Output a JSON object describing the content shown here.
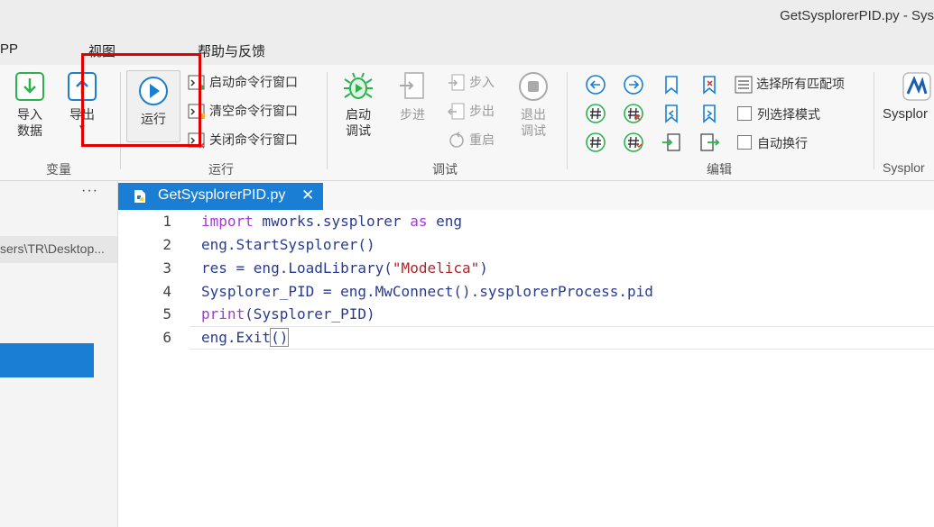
{
  "window": {
    "title": "GetSysplorerPID.py - Sys"
  },
  "menu": [
    "PP",
    "视图",
    "帮助与反馈"
  ],
  "ribbon": {
    "variables": {
      "import_label": [
        "导入",
        "数据"
      ],
      "export_label": [
        "导出"
      ],
      "group": "变量"
    },
    "run": {
      "run_label": "运行",
      "start_cmd": "启动命令行窗口",
      "clear_cmd": "清空命令行窗口",
      "close_cmd": "关闭命令行窗口",
      "group": "运行"
    },
    "debug": {
      "start_label": [
        "启动",
        "调试"
      ],
      "step_label": "步进",
      "step_into": "步入",
      "step_out": "步出",
      "restart": "重启",
      "exit_label": [
        "退出",
        "调试"
      ],
      "group": "调试"
    },
    "edit": {
      "select_all_matches": "选择所有匹配项",
      "column_select": "列选择模式",
      "word_wrap": "自动换行",
      "group": "编辑"
    },
    "sysplorer": {
      "label": "Sysplor",
      "group": "Sysplor"
    }
  },
  "sidebar": {
    "more": "···",
    "path": "sers\\TR\\Desktop..."
  },
  "editor": {
    "tab_name": "GetSysplorerPID.py",
    "lines": [
      {
        "n": "1"
      },
      {
        "n": "2"
      },
      {
        "n": "3"
      },
      {
        "n": "4"
      },
      {
        "n": "5"
      },
      {
        "n": "6"
      }
    ],
    "code": {
      "l1": [
        "import",
        " mworks.sysplorer ",
        "as",
        " eng"
      ],
      "l2": "eng.StartSysplorer()",
      "l3": [
        "res = eng.LoadLibrary(",
        "\"Modelica\"",
        ")"
      ],
      "l4": "Sysplorer_PID = eng.MwConnect().sysplorerProcess.pid",
      "l5": [
        "print",
        "(Sysplorer_PID)"
      ],
      "l6": [
        "eng.Exit",
        "()"
      ]
    }
  },
  "colors": {
    "accent": "#1a7fd4",
    "highlight": "#e00000",
    "keyword": "#a23ad6",
    "string": "#b0252a",
    "green": "#2bb24c"
  },
  "icons": [
    "import-icon",
    "export-icon",
    "run-icon",
    "terminal-start-icon",
    "terminal-clear-icon",
    "terminal-close-icon",
    "bug-icon",
    "step-icon",
    "step-into-icon",
    "step-out-icon",
    "restart-icon",
    "stop-icon",
    "nav-back-icon",
    "nav-forward-icon",
    "bookmark-icon",
    "bookmark-remove-icon",
    "hash-icon",
    "hash-remove-icon",
    "python-file-icon",
    "close-icon"
  ]
}
